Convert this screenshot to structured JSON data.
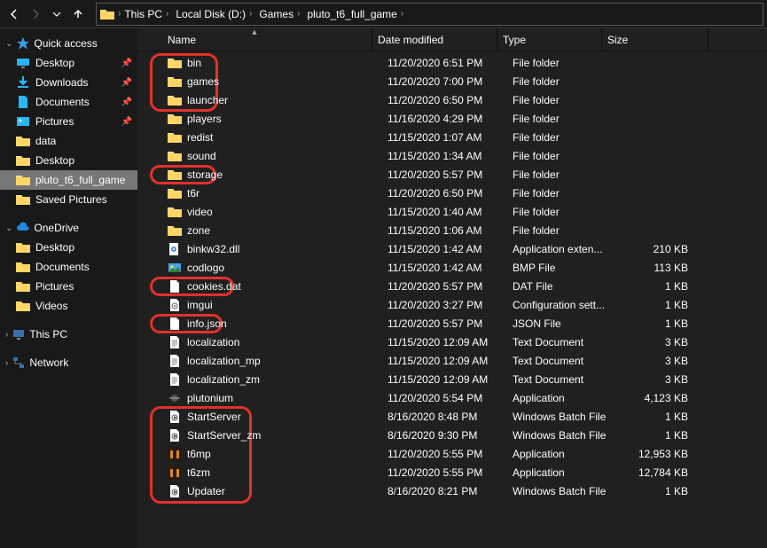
{
  "breadcrumb": [
    "This PC",
    "Local Disk (D:)",
    "Games",
    "pluto_t6_full_game"
  ],
  "sidebar": {
    "quick": {
      "label": "Quick access",
      "items": [
        {
          "label": "Desktop",
          "pin": true,
          "icon": "desktop"
        },
        {
          "label": "Downloads",
          "pin": true,
          "icon": "downloads"
        },
        {
          "label": "Documents",
          "pin": true,
          "icon": "documents"
        },
        {
          "label": "Pictures",
          "pin": true,
          "icon": "pictures"
        },
        {
          "label": "data",
          "pin": false,
          "icon": "folder"
        },
        {
          "label": "Desktop",
          "pin": false,
          "icon": "folder"
        },
        {
          "label": "pluto_t6_full_game",
          "pin": false,
          "icon": "folder",
          "selected": true
        },
        {
          "label": "Saved Pictures",
          "pin": false,
          "icon": "folder"
        }
      ]
    },
    "onedrive": {
      "label": "OneDrive",
      "items": [
        {
          "label": "Desktop",
          "icon": "folder-cloud"
        },
        {
          "label": "Documents",
          "icon": "folder-cloud"
        },
        {
          "label": "Pictures",
          "icon": "folder-cloud"
        },
        {
          "label": "Videos",
          "icon": "folder-cloud"
        }
      ]
    },
    "thispc": {
      "label": "This PC"
    },
    "network": {
      "label": "Network"
    }
  },
  "columns": {
    "name": "Name",
    "date": "Date modified",
    "type": "Type",
    "size": "Size"
  },
  "files": [
    {
      "name": "bin",
      "date": "11/20/2020 6:51 PM",
      "type": "File folder",
      "size": "",
      "icon": "folder"
    },
    {
      "name": "games",
      "date": "11/20/2020 7:00 PM",
      "type": "File folder",
      "size": "",
      "icon": "folder"
    },
    {
      "name": "launcher",
      "date": "11/20/2020 6:50 PM",
      "type": "File folder",
      "size": "",
      "icon": "folder"
    },
    {
      "name": "players",
      "date": "11/16/2020 4:29 PM",
      "type": "File folder",
      "size": "",
      "icon": "folder"
    },
    {
      "name": "redist",
      "date": "11/15/2020 1:07 AM",
      "type": "File folder",
      "size": "",
      "icon": "folder"
    },
    {
      "name": "sound",
      "date": "11/15/2020 1:34 AM",
      "type": "File folder",
      "size": "",
      "icon": "folder"
    },
    {
      "name": "storage",
      "date": "11/20/2020 5:57 PM",
      "type": "File folder",
      "size": "",
      "icon": "folder"
    },
    {
      "name": "t6r",
      "date": "11/20/2020 6:50 PM",
      "type": "File folder",
      "size": "",
      "icon": "folder"
    },
    {
      "name": "video",
      "date": "11/15/2020 1:40 AM",
      "type": "File folder",
      "size": "",
      "icon": "folder"
    },
    {
      "name": "zone",
      "date": "11/15/2020 1:06 AM",
      "type": "File folder",
      "size": "",
      "icon": "folder"
    },
    {
      "name": "binkw32.dll",
      "date": "11/15/2020 1:42 AM",
      "type": "Application exten...",
      "size": "210 KB",
      "icon": "dll"
    },
    {
      "name": "codlogo",
      "date": "11/15/2020 1:42 AM",
      "type": "BMP File",
      "size": "113 KB",
      "icon": "image"
    },
    {
      "name": "cookies.dat",
      "date": "11/20/2020 5:57 PM",
      "type": "DAT File",
      "size": "1 KB",
      "icon": "file"
    },
    {
      "name": "imgui",
      "date": "11/20/2020 3:27 PM",
      "type": "Configuration sett...",
      "size": "1 KB",
      "icon": "cfg"
    },
    {
      "name": "info.json",
      "date": "11/20/2020 5:57 PM",
      "type": "JSON File",
      "size": "1 KB",
      "icon": "file"
    },
    {
      "name": "localization",
      "date": "11/15/2020 12:09 AM",
      "type": "Text Document",
      "size": "3 KB",
      "icon": "txt"
    },
    {
      "name": "localization_mp",
      "date": "11/15/2020 12:09 AM",
      "type": "Text Document",
      "size": "3 KB",
      "icon": "txt"
    },
    {
      "name": "localization_zm",
      "date": "11/15/2020 12:09 AM",
      "type": "Text Document",
      "size": "3 KB",
      "icon": "txt"
    },
    {
      "name": "plutonium",
      "date": "11/20/2020 5:54 PM",
      "type": "Application",
      "size": "4,123 KB",
      "icon": "pluto"
    },
    {
      "name": "StartServer",
      "date": "8/16/2020 8:48 PM",
      "type": "Windows Batch File",
      "size": "1 KB",
      "icon": "bat"
    },
    {
      "name": "StartServer_zm",
      "date": "8/16/2020 9:30 PM",
      "type": "Windows Batch File",
      "size": "1 KB",
      "icon": "bat"
    },
    {
      "name": "t6mp",
      "date": "11/20/2020 5:55 PM",
      "type": "Application",
      "size": "12,953 KB",
      "icon": "t6"
    },
    {
      "name": "t6zm",
      "date": "11/20/2020 5:55 PM",
      "type": "Application",
      "size": "12,784 KB",
      "icon": "t6"
    },
    {
      "name": "Updater",
      "date": "8/16/2020 8:21 PM",
      "type": "Windows Batch File",
      "size": "1 KB",
      "icon": "bat"
    }
  ]
}
